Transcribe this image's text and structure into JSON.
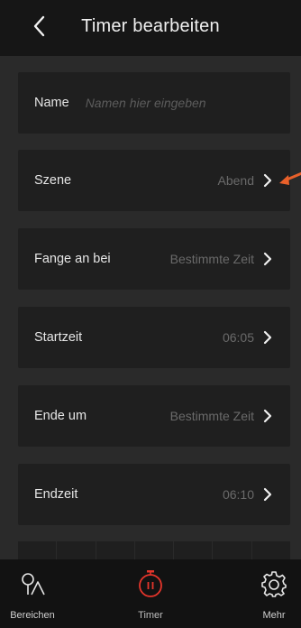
{
  "header": {
    "title": "Timer bearbeiten",
    "back_icon": "back-chevron-icon"
  },
  "rows": [
    {
      "label": "Name",
      "placeholder": "Namen hier eingeben"
    },
    {
      "label": "Szene",
      "value": "Abend"
    },
    {
      "label": "Fange an bei",
      "value": "Bestimmte Zeit"
    },
    {
      "label": "Startzeit",
      "value": "06:05"
    },
    {
      "label": "Ende um",
      "value": "Bestimmte Zeit"
    },
    {
      "label": "Endzeit",
      "value": "06:10"
    }
  ],
  "tabs": [
    {
      "label": "Bereichen",
      "icon": "room-icon"
    },
    {
      "label": "Timer",
      "icon": "timer-icon",
      "active": true
    },
    {
      "label": "Mehr",
      "icon": "gear-icon"
    }
  ],
  "colors": {
    "accent": "#e5352b",
    "annotation": "#e8602a"
  }
}
